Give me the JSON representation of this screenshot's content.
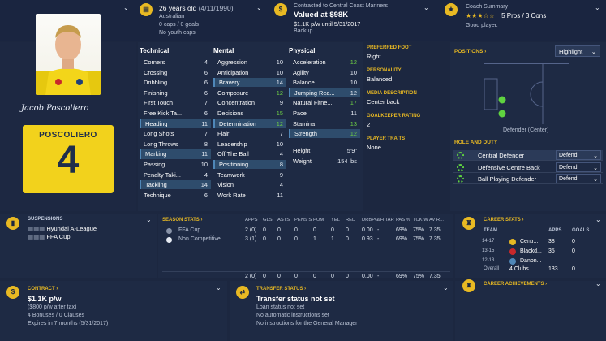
{
  "player": {
    "name_signature": "Jacob Poscoliero",
    "shirt_name": "POSCOLIERO",
    "shirt_number": "4",
    "age_line": "26 years old",
    "dob": "(4/11/1990)",
    "nationality": "Australian",
    "caps": "0 caps / 0 goals",
    "youth_caps": "No youth caps"
  },
  "contract_header": {
    "club_line": "Contracted to Central Coast Mariners",
    "value": "Valued at $98K",
    "wage_line": "$1.1K p/w until 5/31/2017",
    "squad_status": "Backup"
  },
  "coach": {
    "title": "Coach Summary",
    "stars_full": 2.5,
    "stars_max": 5,
    "stars_text": "★★★☆☆",
    "pros_cons": "5 Pros / 3 Cons",
    "verdict": "Good player."
  },
  "attributes": {
    "technical_title": "Technical",
    "mental_title": "Mental",
    "physical_title": "Physical",
    "technical": [
      {
        "name": "Corners",
        "value": "4"
      },
      {
        "name": "Crossing",
        "value": "6"
      },
      {
        "name": "Dribbling",
        "value": "6"
      },
      {
        "name": "Finishing",
        "value": "6"
      },
      {
        "name": "First Touch",
        "value": "7"
      },
      {
        "name": "Free Kick Ta...",
        "value": "6"
      },
      {
        "name": "Heading",
        "value": "11"
      },
      {
        "name": "Long Shots",
        "value": "7"
      },
      {
        "name": "Long Throws",
        "value": "8"
      },
      {
        "name": "Marking",
        "value": "11"
      },
      {
        "name": "Passing",
        "value": "10"
      },
      {
        "name": "Penalty Taki...",
        "value": "4"
      },
      {
        "name": "Tackling",
        "value": "14"
      },
      {
        "name": "Technique",
        "value": "6"
      }
    ],
    "mental": [
      {
        "name": "Aggression",
        "value": "10"
      },
      {
        "name": "Anticipation",
        "value": "10"
      },
      {
        "name": "Bravery",
        "value": "14"
      },
      {
        "name": "Composure",
        "value": "12"
      },
      {
        "name": "Concentration",
        "value": "9"
      },
      {
        "name": "Decisions",
        "value": "15"
      },
      {
        "name": "Determination",
        "value": "12"
      },
      {
        "name": "Flair",
        "value": "7"
      },
      {
        "name": "Leadership",
        "value": "10"
      },
      {
        "name": "Off The Ball",
        "value": "4"
      },
      {
        "name": "Positioning",
        "value": "8"
      },
      {
        "name": "Teamwork",
        "value": "9"
      },
      {
        "name": "Vision",
        "value": "4"
      },
      {
        "name": "Work Rate",
        "value": "11"
      }
    ],
    "physical": [
      {
        "name": "Acceleration",
        "value": "12"
      },
      {
        "name": "Agility",
        "value": "10"
      },
      {
        "name": "Balance",
        "value": "10"
      },
      {
        "name": "Jumping Rea...",
        "value": "12"
      },
      {
        "name": "Natural Fitne...",
        "value": "17"
      },
      {
        "name": "Pace",
        "value": "11"
      },
      {
        "name": "Stamina",
        "value": "13"
      },
      {
        "name": "Strength",
        "value": "12"
      }
    ],
    "height_label": "Height",
    "height_value": "5'9\"",
    "weight_label": "Weight",
    "weight_value": "154 lbs"
  },
  "info": {
    "preferred_foot_label": "PREFERRED FOOT",
    "preferred_foot": "Right",
    "personality_label": "PERSONALITY",
    "personality": "Balanced",
    "media_label": "MEDIA DESCRIPTION",
    "media": "Center back",
    "gk_label": "GOALKEEPER RATING",
    "gk": "2",
    "traits_label": "PLAYER TRAITS",
    "traits": "None"
  },
  "positions": {
    "title": "POSITIONS ›",
    "mode": "Highlight",
    "caption": "Defender (Center)",
    "role_title": "ROLE AND DUTY",
    "roles": [
      {
        "role": "Central Defender",
        "duty": "Defend"
      },
      {
        "role": "Defensive Centre Back",
        "duty": "Defend"
      },
      {
        "role": "Ball Playing Defender",
        "duty": "Defend"
      }
    ]
  },
  "suspensions": {
    "title": "SUSPENSIONS",
    "items": [
      "Hyundai A-League",
      "FFA Cup"
    ]
  },
  "season_stats": {
    "title": "SEASON STATS ›",
    "headers": [
      "APPS",
      "GLS",
      "ASTS",
      "PENS S",
      "POM",
      "YEL",
      "RED",
      "DRBPG",
      "SH TAR",
      "PAS %",
      "TCK W",
      "AV R..."
    ],
    "rows": [
      {
        "comp": "FFA Cup",
        "cells": [
          "2 (0)",
          "0",
          "0",
          "0",
          "0",
          "0",
          "0",
          "0.00",
          "-",
          "69%",
          "75%",
          "7.35"
        ]
      },
      {
        "comp": "Non Competitive",
        "cells": [
          "3 (1)",
          "0",
          "0",
          "0",
          "1",
          "1",
          "0",
          "0.93",
          "-",
          "69%",
          "75%",
          "7.35"
        ]
      }
    ],
    "total": [
      "2 (0)",
      "0",
      "0",
      "0",
      "0",
      "0",
      "0",
      "0.00",
      "-",
      "69%",
      "75%",
      "7.35"
    ]
  },
  "career_stats": {
    "title": "CAREER STATS ›",
    "headers": [
      "TEAM",
      "APPS",
      "GOALS"
    ],
    "rows": [
      {
        "season": "14-17",
        "team": "Centr...",
        "apps": "38",
        "goals": "0"
      },
      {
        "season": "13-15",
        "team": "Blackd...",
        "apps": "35",
        "goals": "0"
      },
      {
        "season": "12-13",
        "team": "Danon...",
        "apps": "",
        "goals": ""
      }
    ],
    "overall_label": "Overall",
    "overall_clubs": "4 Clubs",
    "overall_apps": "133",
    "overall_goals": "0"
  },
  "contract": {
    "title": "CONTRACT ›",
    "wage": "$1.1K p/w",
    "after_tax": "($800 p/w after tax)",
    "bonuses": "4 Bonuses / 0 Clauses",
    "expires": "Expires in 7 months (5/31/2017)"
  },
  "transfer": {
    "title": "TRANSFER STATUS ›",
    "status": "Transfer status not set",
    "loan": "Loan status not set",
    "auto": "No automatic instructions set",
    "gm": "No instructions for the General Manager"
  },
  "achievements": {
    "title": "CAREER ACHIEVEMENTS ›"
  },
  "colors": {
    "accent": "#e8b923",
    "green": "#6ecf45",
    "background": "#1c2740"
  }
}
